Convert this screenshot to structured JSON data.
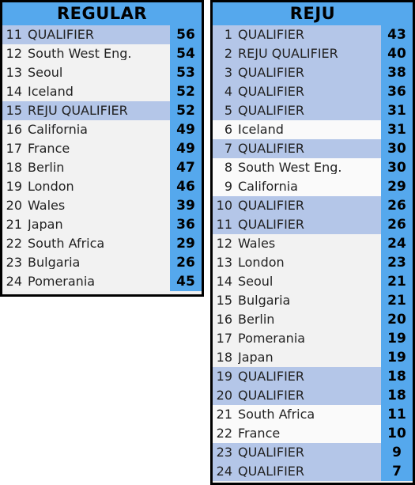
{
  "page": {
    "background_color": "#ffffff",
    "header_blue": "#55a8ed",
    "highlight_blue": "#b4c6e8",
    "row_gray": "#f2f2f2",
    "row_white": "#fafafa",
    "border_color": "#000000"
  },
  "tables": [
    {
      "id": "regular",
      "title": "REGULAR",
      "columns": [
        "rank",
        "name",
        "score"
      ],
      "rows": [
        {
          "rank": "11",
          "name": "QUALIFIER",
          "score": "56",
          "style": "highlight"
        },
        {
          "rank": "12",
          "name": "South West Eng.",
          "score": "54",
          "style": "gray"
        },
        {
          "rank": "13",
          "name": "Seoul",
          "score": "53",
          "style": "gray"
        },
        {
          "rank": "14",
          "name": "Iceland",
          "score": "52",
          "style": "gray"
        },
        {
          "rank": "15",
          "name": "REJU QUALIFIER",
          "score": "52",
          "style": "highlight"
        },
        {
          "rank": "16",
          "name": "California",
          "score": "49",
          "style": "gray"
        },
        {
          "rank": "17",
          "name": "France",
          "score": "49",
          "style": "gray"
        },
        {
          "rank": "18",
          "name": "Berlin",
          "score": "47",
          "style": "gray"
        },
        {
          "rank": "19",
          "name": "London",
          "score": "46",
          "style": "gray"
        },
        {
          "rank": "20",
          "name": "Wales",
          "score": "39",
          "style": "gray"
        },
        {
          "rank": "21",
          "name": "Japan",
          "score": "36",
          "style": "gray"
        },
        {
          "rank": "22",
          "name": "South Africa",
          "score": "29",
          "style": "gray"
        },
        {
          "rank": "23",
          "name": "Bulgaria",
          "score": "26",
          "style": "gray"
        },
        {
          "rank": "24",
          "name": "Pomerania",
          "score": "45",
          "style": "gray"
        }
      ]
    },
    {
      "id": "reju",
      "title": "REJU",
      "columns": [
        "rank",
        "name",
        "score"
      ],
      "rows": [
        {
          "rank": "1",
          "name": "QUALIFIER",
          "score": "43",
          "style": "highlight"
        },
        {
          "rank": "2",
          "name": "REJU QUALIFIER",
          "score": "40",
          "style": "highlight"
        },
        {
          "rank": "3",
          "name": "QUALIFIER",
          "score": "38",
          "style": "highlight"
        },
        {
          "rank": "4",
          "name": "QUALIFIER",
          "score": "36",
          "style": "highlight"
        },
        {
          "rank": "5",
          "name": "QUALIFIER",
          "score": "31",
          "style": "highlight"
        },
        {
          "rank": "6",
          "name": "Iceland",
          "score": "31",
          "style": "white"
        },
        {
          "rank": "7",
          "name": "QUALIFIER",
          "score": "30",
          "style": "highlight"
        },
        {
          "rank": "8",
          "name": "South West Eng.",
          "score": "30",
          "style": "white"
        },
        {
          "rank": "9",
          "name": "California",
          "score": "29",
          "style": "white"
        },
        {
          "rank": "10",
          "name": "QUALIFIER",
          "score": "26",
          "style": "highlight"
        },
        {
          "rank": "11",
          "name": "QUALIFIER",
          "score": "26",
          "style": "highlight"
        },
        {
          "rank": "12",
          "name": "Wales",
          "score": "24",
          "style": "gray"
        },
        {
          "rank": "13",
          "name": "London",
          "score": "23",
          "style": "gray"
        },
        {
          "rank": "14",
          "name": "Seoul",
          "score": "21",
          "style": "gray"
        },
        {
          "rank": "15",
          "name": "Bulgaria",
          "score": "21",
          "style": "gray"
        },
        {
          "rank": "16",
          "name": "Berlin",
          "score": "20",
          "style": "gray"
        },
        {
          "rank": "17",
          "name": "Pomerania",
          "score": "19",
          "style": "gray"
        },
        {
          "rank": "18",
          "name": "Japan",
          "score": "19",
          "style": "gray"
        },
        {
          "rank": "19",
          "name": "QUALIFIER",
          "score": "18",
          "style": "highlight"
        },
        {
          "rank": "20",
          "name": "QUALIFIER",
          "score": "18",
          "style": "highlight"
        },
        {
          "rank": "21",
          "name": "South Africa",
          "score": "11",
          "style": "white"
        },
        {
          "rank": "22",
          "name": "France",
          "score": "10",
          "style": "white"
        },
        {
          "rank": "23",
          "name": "QUALIFIER",
          "score": "9",
          "style": "highlight"
        },
        {
          "rank": "24",
          "name": "QUALIFIER",
          "score": "7",
          "style": "highlight"
        }
      ]
    }
  ]
}
